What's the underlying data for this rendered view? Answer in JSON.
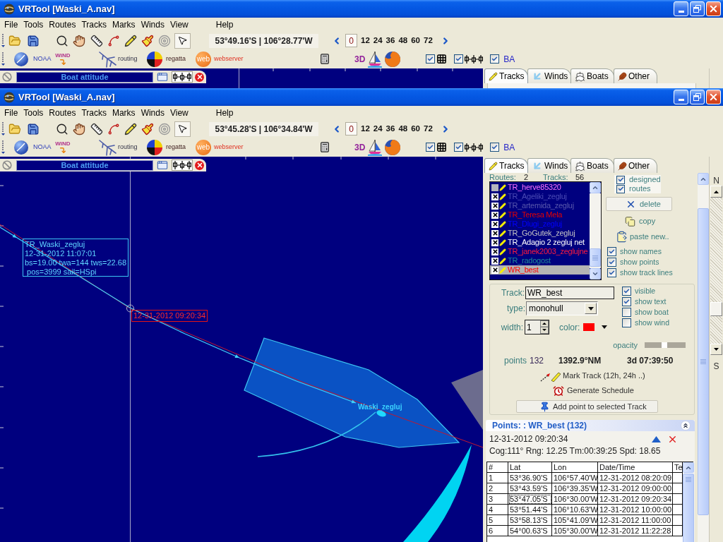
{
  "back_window": {
    "title": "VRTool [Waski_A.nav]",
    "menu": [
      "File",
      "Tools",
      "Routes",
      "Tracks",
      "Marks",
      "Winds",
      "View",
      "Help"
    ],
    "coordinates": "53°49.16'S | 106°28.77'W",
    "time_steps": [
      {
        "label": "0",
        "selected": true
      },
      {
        "label": "12",
        "selected": false
      },
      {
        "label": "24",
        "selected": false
      },
      {
        "label": "36",
        "selected": false
      },
      {
        "label": "48",
        "selected": false
      },
      {
        "label": "60",
        "selected": false
      },
      {
        "label": "72",
        "selected": false
      }
    ],
    "launchers": [
      {
        "kind": "noaa",
        "label": "NOAA"
      },
      {
        "kind": "wind",
        "label": "WiND"
      },
      {
        "kind": "routing",
        "label": "routing"
      },
      {
        "kind": "regatta",
        "label": "regatta"
      },
      {
        "kind": "web",
        "logo": "web",
        "label": "webserver"
      }
    ],
    "view_3d": "3D",
    "toggles": [
      {
        "kind": "grid",
        "checked": true
      },
      {
        "kind": "markers",
        "checked": true
      },
      {
        "kind": "text",
        "label": "BA",
        "checked": true
      }
    ],
    "boat_attitude": {
      "title": "Boat attitude",
      "markers_on": true
    },
    "side_tabs": [
      {
        "label": "Tracks",
        "selected": true
      },
      {
        "label": "Winds",
        "selected": false
      },
      {
        "label": "Boats",
        "selected": false
      },
      {
        "label": "Other",
        "selected": false
      }
    ]
  },
  "front_window": {
    "title": "VRTool [Waski_A.nav]",
    "menu": [
      "File",
      "Tools",
      "Routes",
      "Tracks",
      "Marks",
      "Winds",
      "View",
      "Help"
    ],
    "coordinates": "53°45.28'S | 106°34.84'W",
    "time_steps": [
      {
        "label": "0",
        "selected": true
      },
      {
        "label": "12",
        "selected": false
      },
      {
        "label": "24",
        "selected": false
      },
      {
        "label": "36",
        "selected": false
      },
      {
        "label": "48",
        "selected": false
      },
      {
        "label": "60",
        "selected": false
      },
      {
        "label": "72",
        "selected": false
      }
    ],
    "launchers": [
      {
        "kind": "noaa",
        "label": "NOAA"
      },
      {
        "kind": "wind",
        "label": "WiND"
      },
      {
        "kind": "routing",
        "label": "routing"
      },
      {
        "kind": "regatta",
        "label": "regatta"
      },
      {
        "kind": "web",
        "logo": "web",
        "label": "webserver"
      }
    ],
    "view_3d": "3D",
    "toggles": [
      {
        "kind": "grid",
        "checked": true
      },
      {
        "kind": "markers",
        "checked": true
      },
      {
        "kind": "text",
        "label": "BA",
        "checked": true
      }
    ],
    "boat_attitude": {
      "title": "Boat attitude",
      "markers_on": true
    },
    "side_tabs": [
      {
        "label": "Tracks",
        "selected": true
      },
      {
        "label": "Winds",
        "selected": false
      },
      {
        "label": "Boats",
        "selected": false
      },
      {
        "label": "Other",
        "selected": false
      }
    ],
    "map": {
      "track_info": [
        "TR_Waski_zegluj",
        "12-31-2012 11:07:01",
        "bs=19.00 twa=144 tws=22.68",
        " pos=3999 sail=HSpi"
      ],
      "point_label": "12-31-2012 09:20:34",
      "boat_label": "Waski_zegluj"
    },
    "tracks_panel": {
      "routes_label": "Routes:",
      "routes_count": "2",
      "tracks_label": "Tracks:",
      "tracks_count": "56",
      "layers": [
        {
          "label": "designed",
          "checked": true
        },
        {
          "label": "routes",
          "checked": true
        }
      ],
      "tracks": [
        {
          "name": "TR_herve85320",
          "color": "#ff70ff",
          "visible": false,
          "selected": false
        },
        {
          "name": "TR_Ageliki_zegluj",
          "color": "#4a4ab4",
          "visible": true,
          "selected": false
        },
        {
          "name": "TR_artemida_zegluj",
          "color": "#5858ac",
          "visible": true,
          "selected": false
        },
        {
          "name": "TR_Teresa Mela",
          "color": "#e80000",
          "visible": true,
          "selected": false
        },
        {
          "name": "TR_Dlugi_zegluj",
          "color": "#0000ff",
          "visible": true,
          "selected": false
        },
        {
          "name": "TR_GoGutek_zegluj",
          "color": "#c4c4c4",
          "visible": true,
          "selected": false
        },
        {
          "name": "TR_Adagio 2 zegluj net",
          "color": "#ffffff",
          "visible": true,
          "selected": false
        },
        {
          "name": "TR_janek2003_zeglujne",
          "color": "#ff1a3c",
          "visible": true,
          "selected": false
        },
        {
          "name": "TR_radogost",
          "color": "#1f8a96",
          "visible": true,
          "selected": false
        },
        {
          "name": "WR_best",
          "color": "#ff0000",
          "visible": true,
          "selected": true
        }
      ],
      "actions": [
        {
          "kind": "delete",
          "label": "delete"
        },
        {
          "kind": "copy",
          "label": "copy"
        },
        {
          "kind": "paste",
          "label": "paste new.."
        }
      ],
      "display_options": [
        {
          "label": "show names",
          "checked": true
        },
        {
          "label": "show points",
          "checked": true
        },
        {
          "label": "show track lines",
          "checked": true
        }
      ]
    },
    "track_properties": {
      "track_label": "Track:",
      "track_name": "WR_best",
      "type_label": "type:",
      "type_value": "monohull",
      "width_label": "width:",
      "width_value": "1",
      "color_label": "color:",
      "color": "#ff0000",
      "options": [
        {
          "label": "visible",
          "checked": true
        },
        {
          "label": "show text",
          "checked": true
        },
        {
          "label": "show boat",
          "checked": false
        },
        {
          "label": "show wind",
          "checked": false
        }
      ],
      "opacity_label": "opacity",
      "opacity": {
        "level": 0.48
      },
      "points_label": "points",
      "points_count": "132",
      "distance": "1392.9°NM",
      "duration": "3d 07:39:50",
      "mark_track": "Mark Track (12h, 24h ..)",
      "schedule": "Generate Schedule",
      "add_point": "Add point to selected Track"
    },
    "points_panel": {
      "title": "Points: : WR_best (132)",
      "time": "12-31-2012 09:20:34",
      "stats": "Cog:111° Rng: 12.25 Tm:00:39:25 Spd: 18.65",
      "columns": [
        "#",
        "Lat",
        "Lon",
        "Date/Time",
        "Te"
      ],
      "rows": [
        {
          "cells": [
            "1",
            "53°36.90'S",
            "106°57.40'W",
            "12-31-2012 08:20:09"
          ],
          "focused": false
        },
        {
          "cells": [
            "2",
            "53°43.59'S",
            "106°39.35'W",
            "12-31-2012 09:00:00"
          ],
          "focused": false
        },
        {
          "cells": [
            "3",
            "53°47.05'S",
            "106°30.00'W",
            "12-31-2012 09:20:34"
          ],
          "focused": true
        },
        {
          "cells": [
            "4",
            "53°51.44'S",
            "106°10.63'W",
            "12-31-2012 10:00:00"
          ],
          "focused": false
        },
        {
          "cells": [
            "5",
            "53°58.13'S",
            "105°41.09'W",
            "12-31-2012 11:00:00"
          ],
          "focused": false
        },
        {
          "cells": [
            "6",
            "54°00.63'S",
            "105°30.00'W",
            "12-31-2012 11:22:28"
          ],
          "focused": false
        }
      ]
    },
    "compass": {
      "north": "N",
      "south": "S",
      "slider": {
        "level": 0.21
      }
    }
  }
}
